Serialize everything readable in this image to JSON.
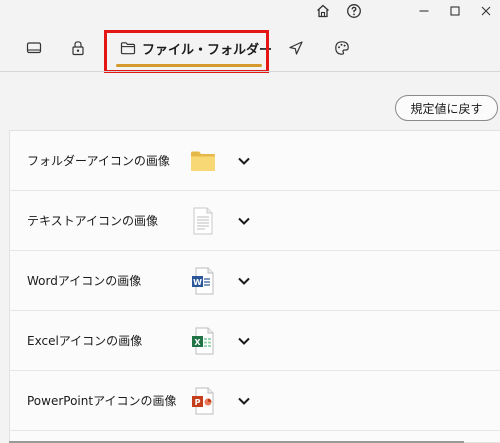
{
  "titlebar": {
    "home_icon": "home-icon",
    "help_icon": "help-icon",
    "minimize_icon": "minimize-icon",
    "maximize_icon": "maximize-icon",
    "close_icon": "close-icon"
  },
  "tabs": [
    {
      "icon": "monitor-icon",
      "label": ""
    },
    {
      "icon": "lock-icon",
      "label": ""
    },
    {
      "icon": "folder-outline-icon",
      "label": "ファイル・フォルダー",
      "active": true
    },
    {
      "icon": "send-icon",
      "label": ""
    },
    {
      "icon": "palette-icon",
      "label": ""
    }
  ],
  "reset_button": {
    "label": "規定値に戻す"
  },
  "rows": [
    {
      "label": "フォルダーアイコンの画像",
      "icon": "folder-icon"
    },
    {
      "label": "テキストアイコンの画像",
      "icon": "text-file-icon"
    },
    {
      "label": "Wordアイコンの画像",
      "icon": "word-file-icon"
    },
    {
      "label": "Excelアイコンの画像",
      "icon": "excel-file-icon"
    },
    {
      "label": "PowerPointアイコンの画像",
      "icon": "powerpoint-file-icon"
    }
  ],
  "colors": {
    "accent_underline": "#d59a2c",
    "highlight_border": "#e31515",
    "word": "#2b579a",
    "excel": "#217346",
    "powerpoint": "#c43e1c",
    "folder": "#f8d775"
  }
}
